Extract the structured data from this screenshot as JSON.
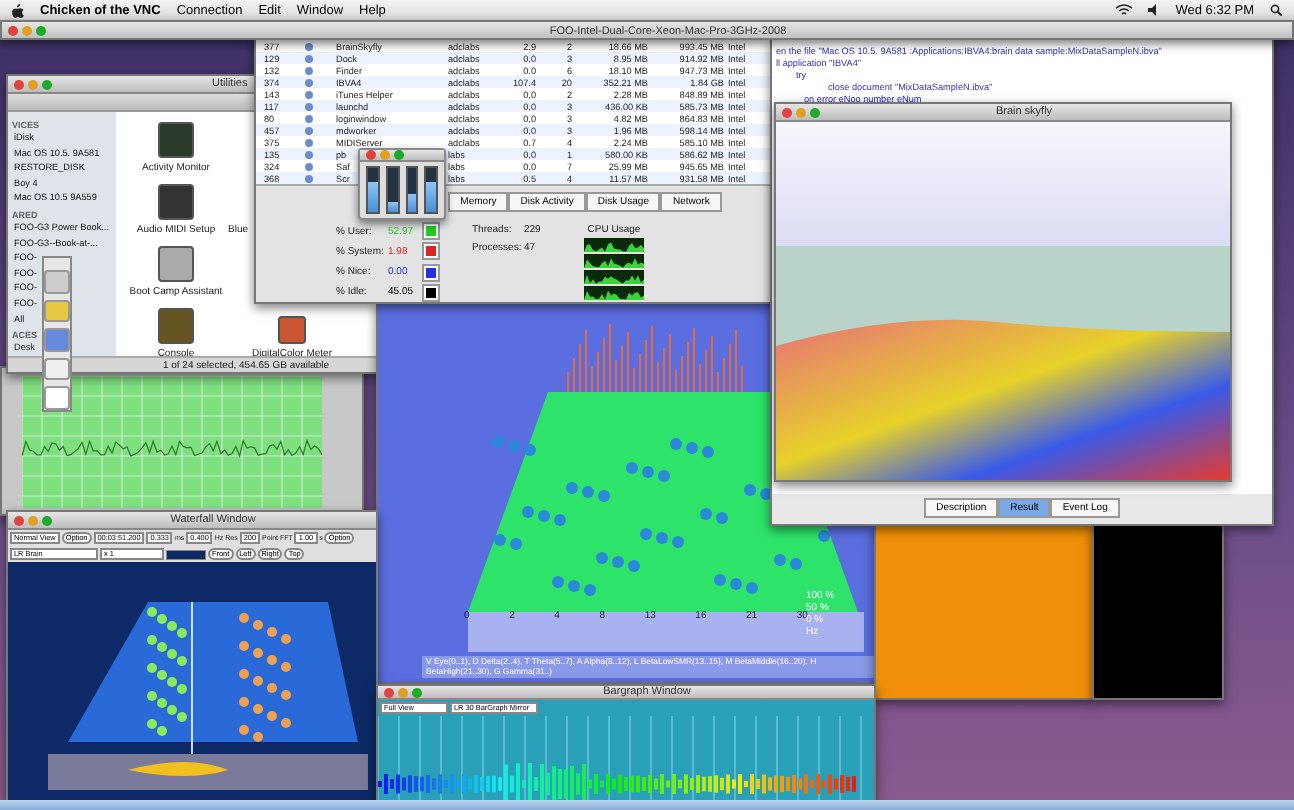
{
  "menu_bar": {
    "app": "Chicken of the VNC",
    "items": [
      "Connection",
      "Edit",
      "Window",
      "Help"
    ],
    "clock": "Wed 6:32 PM"
  },
  "vnc_window": {
    "title": "FOO-Intel-Dual-Core-Xeon-Mac-Pro-3GHz-2008"
  },
  "activity_monitor": {
    "processes": [
      {
        "pid": "377",
        "name": "BrainSkyfly",
        "user": "adclabs",
        "cpu": "2.9",
        "threads": "2",
        "real_mem": "18.66 MB",
        "virtual_mem": "993.45 MB",
        "kind": "Intel"
      },
      {
        "pid": "129",
        "name": "Dock",
        "user": "adclabs",
        "cpu": "0.0",
        "threads": "3",
        "real_mem": "8.95 MB",
        "virtual_mem": "914.92 MB",
        "kind": "Intel"
      },
      {
        "pid": "132",
        "name": "Finder",
        "user": "adclabs",
        "cpu": "0.0",
        "threads": "6",
        "real_mem": "18.10 MB",
        "virtual_mem": "947.73 MB",
        "kind": "Intel"
      },
      {
        "pid": "374",
        "name": "IBVA4",
        "user": "adclabs",
        "cpu": "107.4",
        "threads": "20",
        "real_mem": "352.21 MB",
        "virtual_mem": "1.84 GB",
        "kind": "Intel"
      },
      {
        "pid": "143",
        "name": "iTunes Helper",
        "user": "adclabs",
        "cpu": "0.0",
        "threads": "2",
        "real_mem": "2.28 MB",
        "virtual_mem": "848.89 MB",
        "kind": "Intel"
      },
      {
        "pid": "117",
        "name": "launchd",
        "user": "adclabs",
        "cpu": "0.0",
        "threads": "3",
        "real_mem": "436.00 KB",
        "virtual_mem": "585.73 MB",
        "kind": "Intel"
      },
      {
        "pid": "80",
        "name": "loginwindow",
        "user": "adclabs",
        "cpu": "0.0",
        "threads": "3",
        "real_mem": "4.82 MB",
        "virtual_mem": "864.83 MB",
        "kind": "Intel"
      },
      {
        "pid": "457",
        "name": "mdworker",
        "user": "adclabs",
        "cpu": "0.0",
        "threads": "3",
        "real_mem": "1.96 MB",
        "virtual_mem": "598.14 MB",
        "kind": "Intel"
      },
      {
        "pid": "375",
        "name": "MIDIServer",
        "user": "adclabs",
        "cpu": "0.7",
        "threads": "4",
        "real_mem": "2.24 MB",
        "virtual_mem": "585.10 MB",
        "kind": "Intel"
      },
      {
        "pid": "135",
        "name": "pb",
        "user": "labs",
        "cpu": "0.0",
        "threads": "1",
        "real_mem": "580.00 KB",
        "virtual_mem": "586.62 MB",
        "kind": "Intel"
      },
      {
        "pid": "324",
        "name": "Saf",
        "user": "labs",
        "cpu": "0.0",
        "threads": "7",
        "real_mem": "25.99 MB",
        "virtual_mem": "945.65 MB",
        "kind": "Intel"
      },
      {
        "pid": "368",
        "name": "Scr",
        "user": "labs",
        "cpu": "0.5",
        "threads": "4",
        "real_mem": "11.57 MB",
        "virtual_mem": "931.58 MB",
        "kind": "Intel"
      }
    ],
    "tabs": [
      {
        "label": "Memory",
        "selected": false
      },
      {
        "label": "Disk Activity",
        "selected": false
      },
      {
        "label": "Disk Usage",
        "selected": false
      },
      {
        "label": "Network",
        "selected": false
      }
    ],
    "stats": [
      {
        "label": "% User:",
        "value": "52.97",
        "color": "#22cc22"
      },
      {
        "label": "% System:",
        "value": "1.98",
        "color": "#dd2222"
      },
      {
        "label": "% Nice:",
        "value": "0.00",
        "color": "#2233dd"
      },
      {
        "label": "% Idle:",
        "value": "45.05",
        "color": "#000000"
      }
    ],
    "counts": [
      {
        "label": "Threads:",
        "value": "229"
      },
      {
        "label": "Processes:",
        "value": "47"
      }
    ],
    "cpu_usage_title": "CPU Usage"
  },
  "cpu_meter": {
    "bars": [
      {
        "level": 0.69
      },
      {
        "level": 0.25
      },
      {
        "level": 0.41
      },
      {
        "level": 0.69
      }
    ]
  },
  "finder": {
    "title": "Utilities",
    "sections": [
      {
        "heading": "VICES",
        "items": [
          "iDisk",
          "Mac OS 10.5. 9A581",
          "RESTORE_DISK",
          "Boy 4",
          "Mac OS 10.5 9A559"
        ]
      },
      {
        "heading": "ARED",
        "items": [
          "FOO-G3 Power Book...",
          "FOO-G3--Book-at-...",
          "FOO-",
          "FOO-",
          "FOO-",
          "FOO-",
          "All"
        ]
      },
      {
        "heading": "ACES",
        "items": [
          "Desk"
        ]
      }
    ],
    "apps": [
      "Activity Monitor",
      "Audio MIDI Setup",
      "Boot Camp Assistant",
      "Console"
    ],
    "apps_col2": [
      "Blue",
      "DigitalColor Meter"
    ],
    "status": "1 of 24 selected, 454.65 GB available"
  },
  "script_editor": {
    "lines": [
      "en the file \"Mac OS 10.5. 9A581 :Applications:IBVA4:brain data sample:MixDataSampleN.ibva\"",
      "ll application \"IBVA4\"",
      "try",
      "close document \"MixDataSampleN.ibva\"",
      "on error eNoo number eNum"
    ],
    "tabs": [
      {
        "label": "Description",
        "selected": false
      },
      {
        "label": "Result",
        "selected": true
      },
      {
        "label": "Event Log",
        "selected": false
      }
    ]
  },
  "skyfly": {
    "title": "Brain skyfly"
  },
  "main_view": {
    "axis_labels": [
      "0",
      "2",
      "4",
      "8",
      "13",
      "16",
      "21",
      "30"
    ],
    "percent_labels": [
      "100 %",
      "50 %",
      "0 %"
    ],
    "unit": "Hz",
    "legend": "V Eye(0..1), D Delta(2..4), T Theta(5..7), A Alpha(8..12), L BetaLowSMR(13..15), M BetaMiddle(16..20), H BetaHigh(21..30), G Gamma(31..)"
  },
  "waterfall": {
    "title": "Waterfall Window",
    "view": "Normal View",
    "option": "Option",
    "time": "00:03:51.200",
    "step": "0.333",
    "step_unit": "ms",
    "res": "0.400",
    "res_unit": "Hz Res",
    "fft": "200",
    "fft_unit": "Point FFT",
    "scale": "1.00",
    "scale_unit": "s",
    "option2": "Option",
    "channel": "LR Brain",
    "zoom": "x 1",
    "views": [
      "Front",
      "Left",
      "Right",
      "Top"
    ]
  },
  "bargraph": {
    "title": "Bargraph Window",
    "view": "Full View",
    "mode": "LR 30 BarGraph Mirror"
  }
}
